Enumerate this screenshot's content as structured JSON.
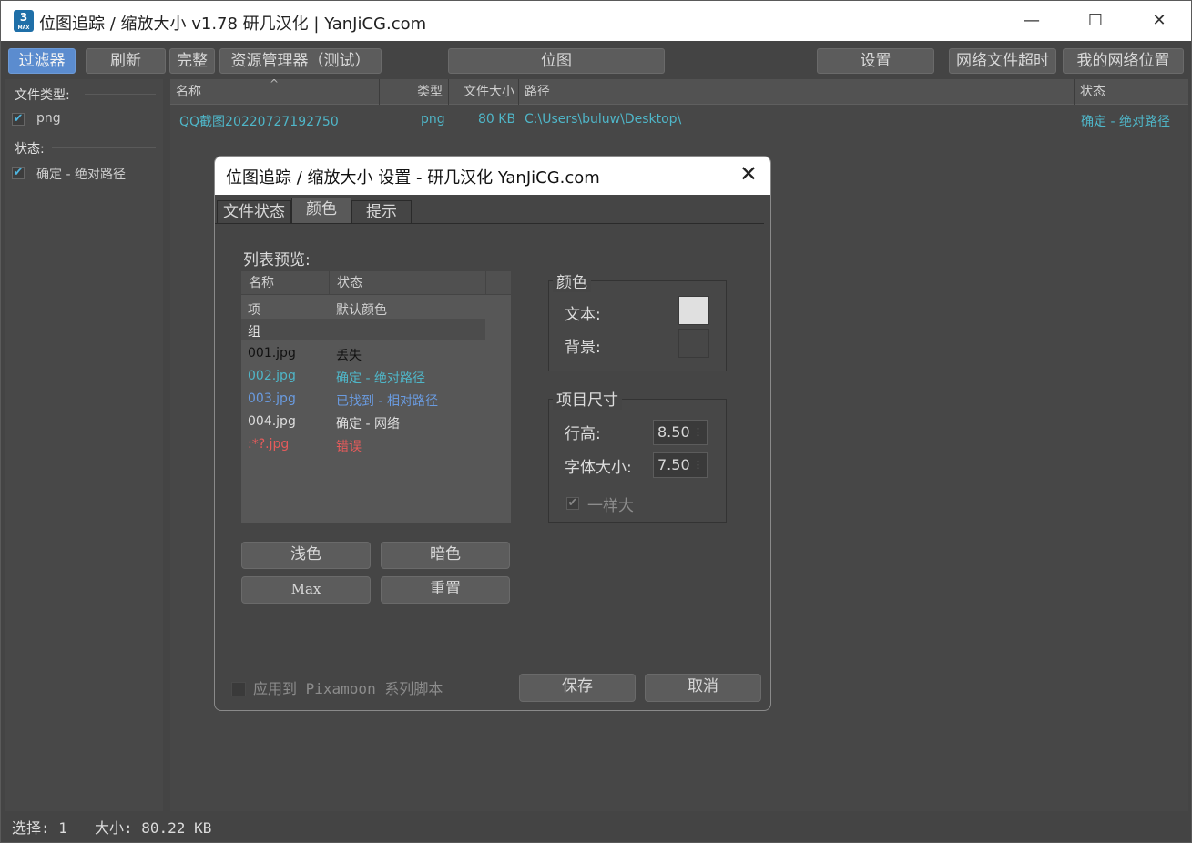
{
  "window": {
    "title": "位图追踪 / 缩放大小  v1.78  研几汉化 | YanJiCG.com",
    "icon_text": "3",
    "icon_sub": "MAX",
    "controls": [
      "—",
      "☐",
      "✕"
    ]
  },
  "toolbar": {
    "filter": "过滤器",
    "refresh": "刷新",
    "complete": "完整",
    "explorer": "资源管理器（测试）",
    "bitmap": "位图",
    "settings": "设置",
    "network_timeout": "网络文件超时",
    "my_network": "我的网络位置"
  },
  "sidebar": {
    "file_type_label": "文件类型:",
    "file_types": [
      {
        "label": "png",
        "checked": true
      }
    ],
    "status_label": "状态:",
    "statuses": [
      {
        "label": "确定 - 绝对路径",
        "checked": true
      }
    ]
  },
  "list": {
    "columns": [
      "名称",
      "类型",
      "文件大小",
      "路径",
      "状态"
    ],
    "sort_indicator": "^",
    "rows": [
      {
        "name": "QQ截图20220727192750",
        "type": "png",
        "size": "80 KB",
        "path": "C:\\Users\\buluw\\Desktop\\",
        "status": "确定 - 绝对路径"
      }
    ]
  },
  "statusbar": {
    "selection": "选择: 1",
    "size": "大小: 80.22 KB"
  },
  "dialog": {
    "title": "位图追踪 / 缩放大小 设置 - 研几汉化 YanJiCG.com",
    "close": "✕",
    "tabs": [
      "文件状态",
      "颜色",
      "提示"
    ],
    "active_tab": 1,
    "preview_label": "列表预览:",
    "preview_columns": [
      "名称",
      "状态"
    ],
    "preview_rows": [
      {
        "name": "项",
        "status": "默认颜色",
        "color": "#cfcfcf"
      },
      {
        "name": "组",
        "status": "",
        "color": "#e8e8e8"
      },
      {
        "name": "001.jpg",
        "status": "丢失",
        "color": "#111111"
      },
      {
        "name": "002.jpg",
        "status": "确定 - 绝对路径",
        "color": "#4fb6c8"
      },
      {
        "name": "003.jpg",
        "status": "已找到 - 相对路径",
        "color": "#6a9be0"
      },
      {
        "name": "004.jpg",
        "status": "确定 - 网络",
        "color": "#dddddd"
      },
      {
        "name": ":*?.jpg",
        "status": "错误",
        "color": "#e65b5b"
      }
    ],
    "buttons": {
      "light": "浅色",
      "dark": "暗色",
      "max": "Max",
      "reset": "重置",
      "save": "保存",
      "cancel": "取消"
    },
    "color_group": {
      "title": "颜色",
      "text_label": "文本:",
      "text_color": "#e0e0e0",
      "bg_label": "背景:",
      "bg_color": "#474747"
    },
    "size_group": {
      "title": "项目尺寸",
      "row_height_label": "行高:",
      "row_height": "8.50",
      "font_size_label": "字体大小:",
      "font_size": "7.50",
      "same_label": "一样大",
      "same_checked": true
    },
    "apply_pixamoon": "应用到 Pixamoon 系列脚本"
  },
  "colors": {
    "accent": "#5b8ccf",
    "ok_text": "#4fb6c8",
    "background": "#444444"
  }
}
